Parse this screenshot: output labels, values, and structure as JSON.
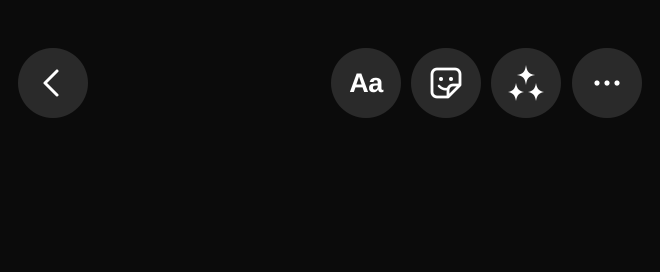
{
  "toolbar": {
    "back": {
      "icon": "chevron-left-icon"
    },
    "text_tool": {
      "label": "Aa"
    },
    "sticker": {
      "icon": "sticker-icon"
    },
    "effects": {
      "icon": "sparkles-icon"
    },
    "more": {
      "icon": "ellipsis-icon"
    }
  },
  "colors": {
    "background": "#0b0b0b",
    "button_fill": "#2a2a2a",
    "icon": "#ffffff"
  }
}
